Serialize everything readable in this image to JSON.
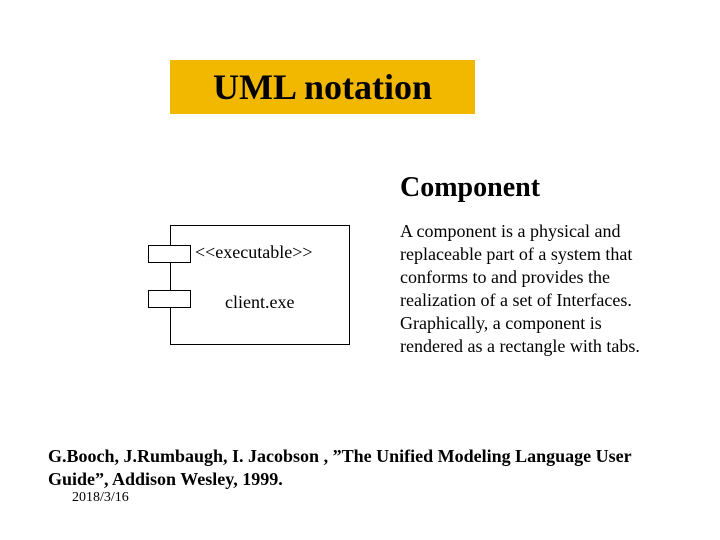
{
  "title": "UML notation",
  "section_heading": "Component",
  "description": "A component is a physical and replaceable part of a system that conforms to and provides the realization of a set of Interfaces. Graphically, a component is rendered as a rectangle with tabs.",
  "component": {
    "stereotype": "<<executable>>",
    "name": "client.exe"
  },
  "citation": "G.Booch, J.Rumbaugh, I. Jacobson , ”The Unified Modeling Language User Guide”, Addison Wesley, 1999.",
  "date": "2018/3/16"
}
